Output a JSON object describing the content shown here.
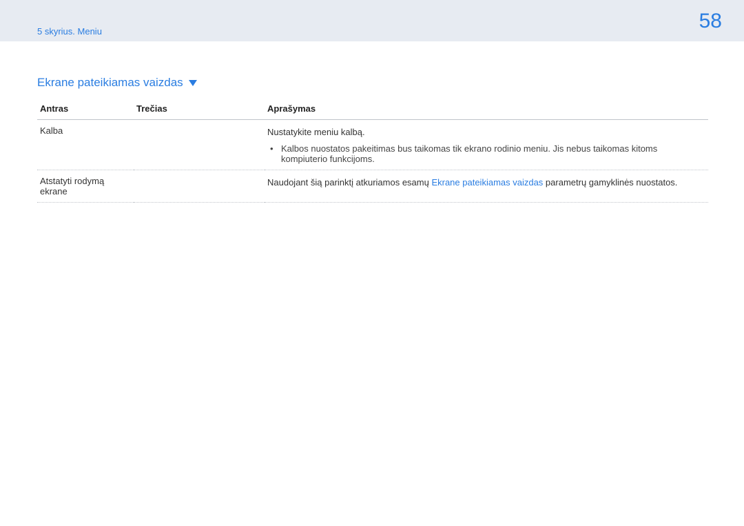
{
  "header": {
    "breadcrumb": "5 skyrius. Meniu",
    "page_number": "58"
  },
  "section": {
    "title": "Ekrane pateikiamas vaizdas"
  },
  "table": {
    "headers": {
      "antras": "Antras",
      "trecias": "Trečias",
      "aprasymas": "Aprašymas"
    },
    "rows": [
      {
        "antras": "Kalba",
        "trecias": "",
        "desc_main": "Nustatykite meniu kalbą.",
        "bullet": "Kalbos nuostatos pakeitimas bus taikomas tik ekrano rodinio meniu. Jis nebus taikomas kitoms kompiuterio funkcijoms."
      },
      {
        "antras": "Atstatyti rodymą ekrane",
        "trecias": "",
        "desc_pre": "Naudojant šią parinktį atkuriamos esamų ",
        "desc_link": "Ekrane pateikiamas vaizdas",
        "desc_post": " parametrų gamyklinės nuostatos."
      }
    ]
  }
}
